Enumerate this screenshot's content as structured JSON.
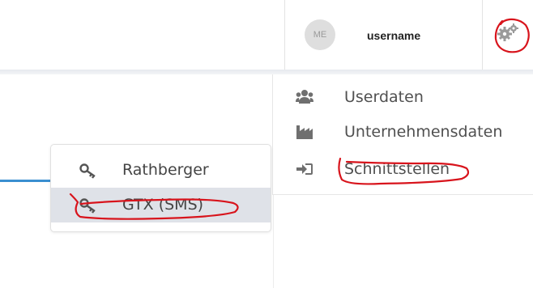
{
  "header": {
    "avatar_initials": "ME",
    "username": "username",
    "settings_icon": "gear-icon"
  },
  "settings_menu": {
    "items": [
      {
        "label": "Userdaten",
        "icon": "users-icon"
      },
      {
        "label": "Unternehmensdaten",
        "icon": "factory-icon"
      },
      {
        "label": "Schnittstellen",
        "icon": "sign-in-icon"
      }
    ]
  },
  "interface_menu": {
    "items": [
      {
        "label": "Rathberger",
        "icon": "key-icon",
        "selected": false
      },
      {
        "label": "GTX (SMS)",
        "icon": "key-icon",
        "selected": true
      }
    ]
  },
  "colors": {
    "annotation": "#d8141c",
    "accent_blue": "#3a8fd0",
    "selected_bg": "#dfe2e8"
  }
}
